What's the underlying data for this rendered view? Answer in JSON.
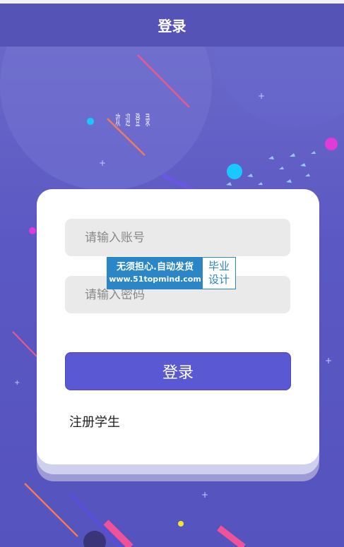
{
  "header": {
    "title": "登录"
  },
  "welcome": {
    "chars": [
      "欢",
      "迎",
      "登",
      "录"
    ]
  },
  "form": {
    "account_placeholder": "请输入账号",
    "password_placeholder": "请输入密码",
    "login_label": "登录",
    "register_label": "注册学生"
  },
  "watermark": {
    "line1": "无须担心.自动发货",
    "line2": "www.51topmind.com",
    "right_line1": "毕业",
    "right_line2": "设计"
  },
  "colors": {
    "header_bg": "#5553b6",
    "background": "#5f5cc4",
    "button": "#5a58d2",
    "input_bg": "#eaeaea",
    "watermark_blue": "#2a86c6"
  }
}
